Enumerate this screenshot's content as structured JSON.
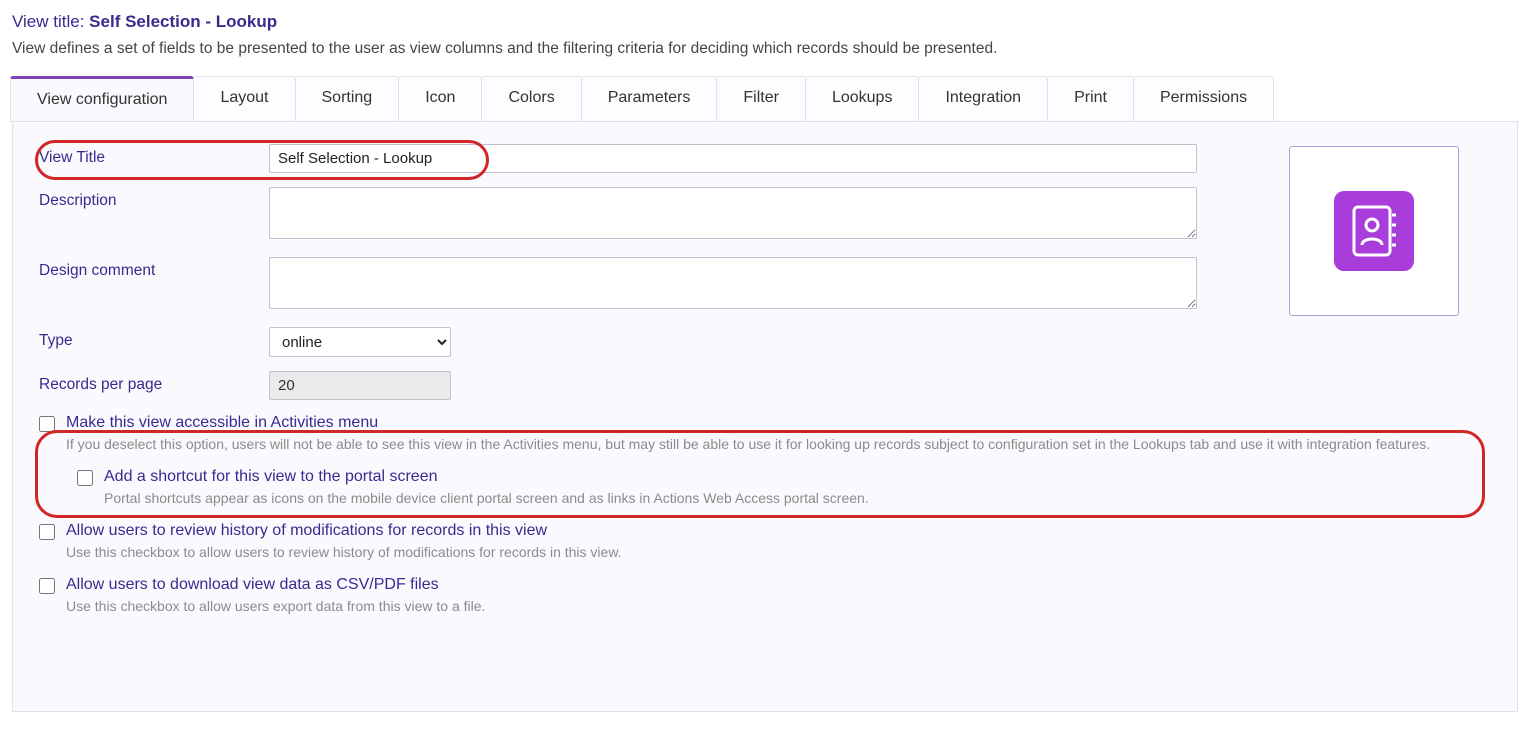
{
  "header": {
    "prefix": "View title: ",
    "title": "Self Selection - Lookup",
    "description": "View defines a set of fields to be presented to the user as view columns and the filtering criteria for deciding which records should be presented."
  },
  "tabs": [
    "View configuration",
    "Layout",
    "Sorting",
    "Icon",
    "Colors",
    "Parameters",
    "Filter",
    "Lookups",
    "Integration",
    "Print",
    "Permissions"
  ],
  "form": {
    "view_title_label": "View Title",
    "view_title_value": "Self Selection - Lookup",
    "description_label": "Description",
    "description_value": "",
    "design_comment_label": "Design comment",
    "design_comment_value": "",
    "type_label": "Type",
    "type_value": "online",
    "records_per_page_label": "Records per page",
    "records_per_page_value": "20"
  },
  "checkboxes": {
    "accessible": {
      "label": "Make this view accessible in Activities menu",
      "hint": "If you deselect this option, users will not be able to see this view in the Activities menu, but may still be able to use it for looking up records subject to configuration set in the Lookups tab and use it with integration features."
    },
    "shortcut": {
      "label": "Add a shortcut for this view to the portal screen",
      "hint": "Portal shortcuts appear as icons on the mobile device client portal screen and as links in Actions Web Access portal screen."
    },
    "history": {
      "label": "Allow users to review history of modifications for records in this view",
      "hint": "Use this checkbox to allow users to review history of modifications for records in this view."
    },
    "download": {
      "label": "Allow users to download view data as CSV/PDF files",
      "hint": "Use this checkbox to allow users export data from this view to a file."
    }
  }
}
